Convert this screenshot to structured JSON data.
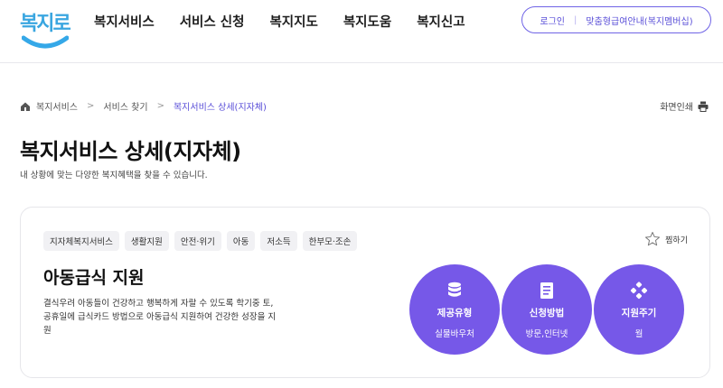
{
  "header": {
    "logo_text": "복지로",
    "nav": [
      "복지서비스",
      "서비스 신청",
      "복지지도",
      "복지도움",
      "복지신고"
    ],
    "login": "로그인",
    "guide": "맞춤형급여안내(복지멤버십)"
  },
  "breadcrumb": {
    "items": [
      "복지서비스",
      "서비스 찾기"
    ],
    "current": "복지서비스 상세(지자체)"
  },
  "print_label": "화면인쇄",
  "page": {
    "title": "복지서비스 상세(지자체)",
    "subtitle": "내 상황에 맞는 다양한 복지혜택을 찾을 수 있습니다."
  },
  "card": {
    "tags": [
      "지자체복지서비스",
      "생활지원",
      "안전·위기",
      "아동",
      "저소득",
      "한부모·조손"
    ],
    "favorite": "찜하기",
    "title": "아동급식 지원",
    "description": "결식우려 아동들이 건강하고 행복하게 자랄 수 있도록 학기중 토,공휴일에 급식카드 방법으로 아동급식 지원하여 건강한 성장을 지원",
    "info": [
      {
        "icon": "database-icon",
        "label": "제공유형",
        "value": "실물바우처"
      },
      {
        "icon": "document-icon",
        "label": "신청방법",
        "value": "방문,인터넷"
      },
      {
        "icon": "cycle-icon",
        "label": "지원주기",
        "value": "월"
      }
    ]
  },
  "colors": {
    "accent": "#7658e8",
    "link": "#5a4fd8",
    "logo": "#3aa6e0"
  }
}
